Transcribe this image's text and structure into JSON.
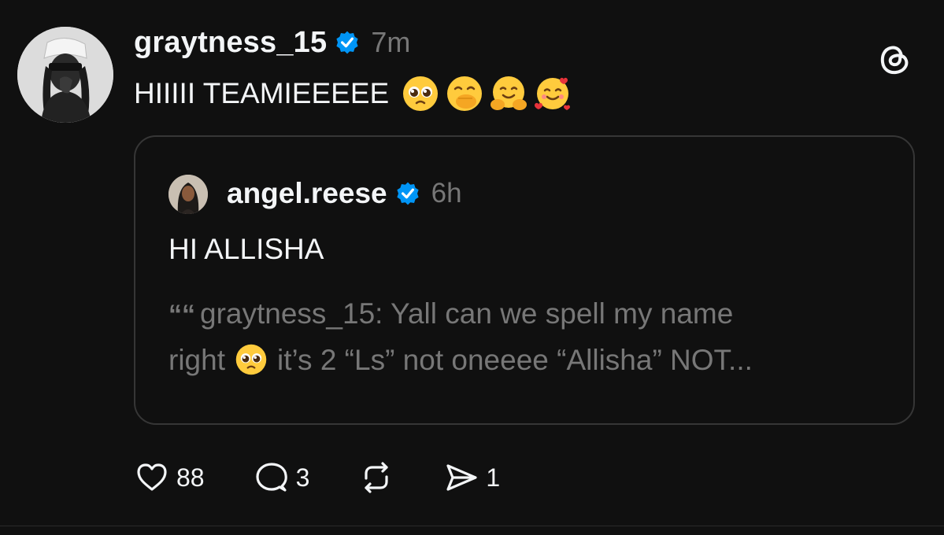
{
  "post": {
    "username": "graytness_15",
    "time": "7m",
    "text": "HIIIII TEAMIEEEEE",
    "emojis": [
      "pleading-face-emoji",
      "face-with-hand-over-mouth-emoji",
      "hugging-face-emoji",
      "smiling-face-with-hearts-emoji"
    ],
    "verified": true
  },
  "quoted_post": {
    "username": "angel.reese",
    "time": "6h",
    "text": "HI ALLISHA",
    "verified": true,
    "nested_quote": {
      "quote_mark": "““",
      "line1": "graytness_15: Yall can we spell my name",
      "line2_before": "right",
      "line2_after": "it’s 2 “Ls” not oneeee “Allisha” NOT...",
      "emoji": "pleading-face-emoji"
    }
  },
  "actions": {
    "likes": "88",
    "replies": "3",
    "shares": "1"
  },
  "colors": {
    "background": "#101010",
    "text": "#f3f5f7",
    "muted": "#777777",
    "verified": "#0095f6",
    "border": "#363636"
  },
  "icons": {
    "app_logo": "threads-logo-icon",
    "like": "heart-icon",
    "reply": "comment-icon",
    "repost": "repost-icon",
    "share": "send-icon"
  }
}
